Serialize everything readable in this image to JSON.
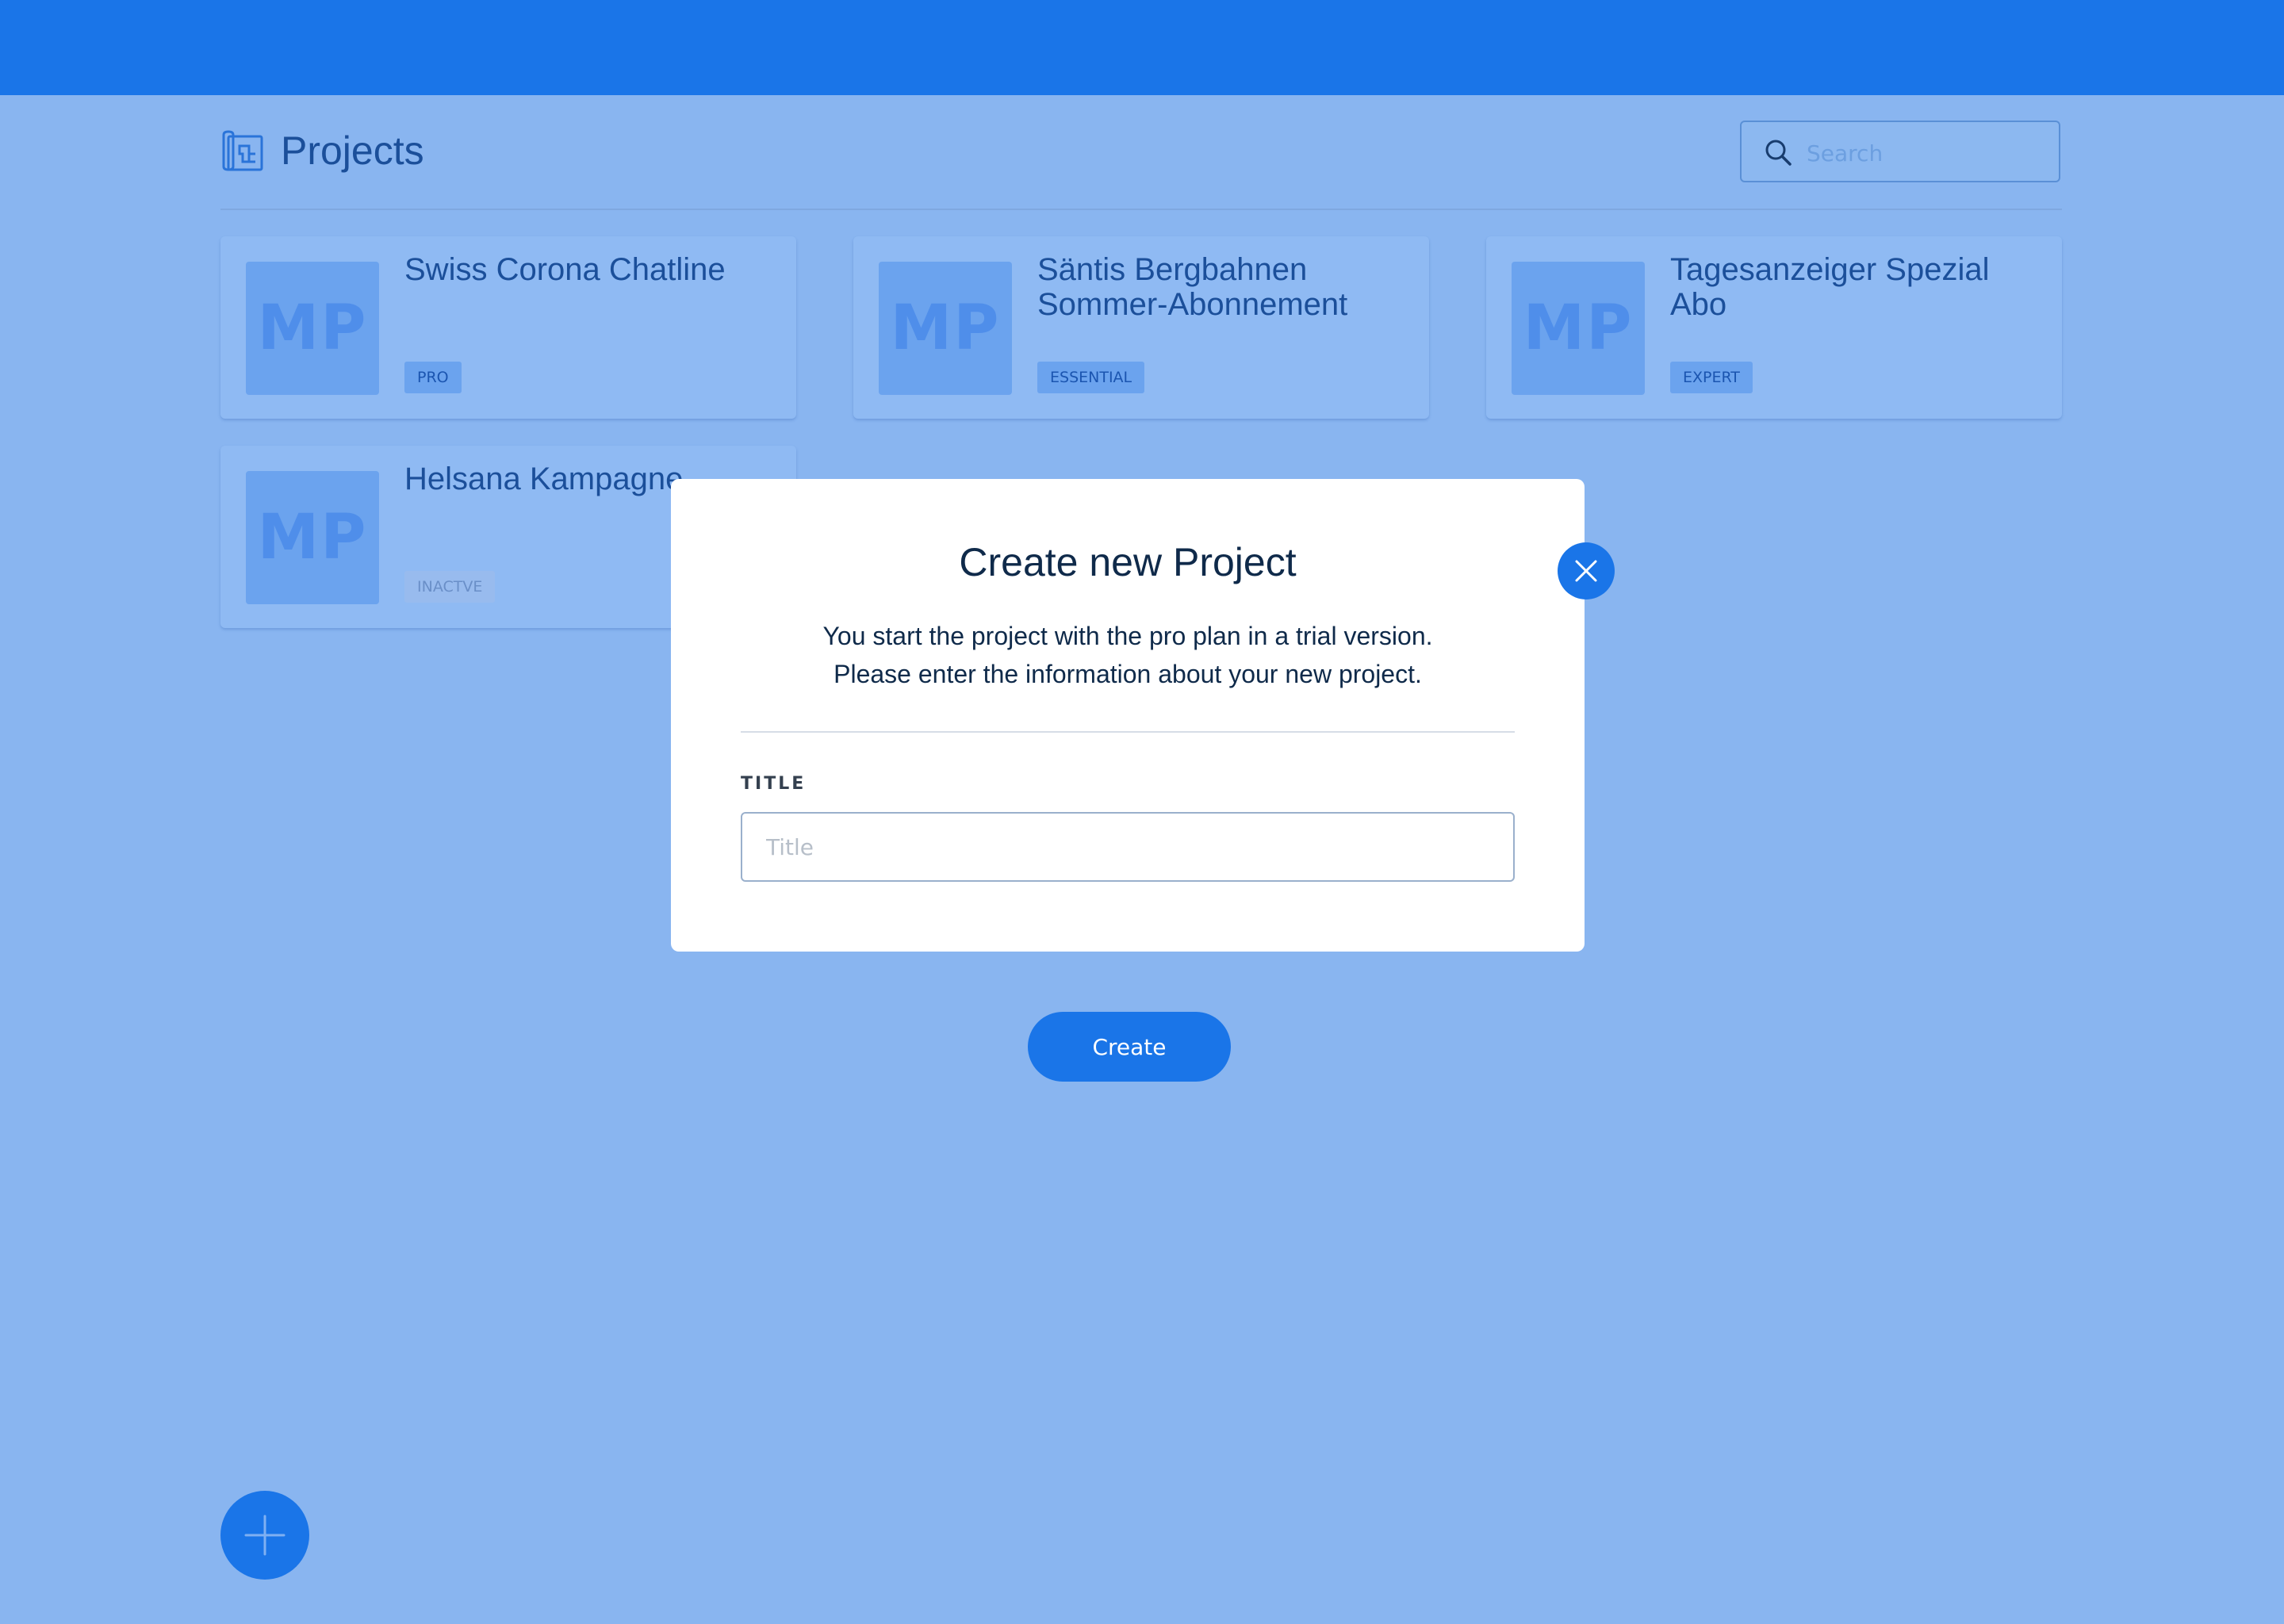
{
  "header": {
    "title": "Projects",
    "icon": "blueprint-icon"
  },
  "search": {
    "placeholder": "Search",
    "icon": "search-icon"
  },
  "projects": [
    {
      "initials": "MP",
      "title": "Swiss Corona Chatline",
      "plan": "PRO",
      "status": "active"
    },
    {
      "initials": "MP",
      "title": "Säntis Bergbahnen Sommer-Abonnement",
      "plan": "ESSENTIAL",
      "status": "active"
    },
    {
      "initials": "MP",
      "title": "Tagesanzeiger Spezial Abo",
      "plan": "EXPERT",
      "status": "active"
    },
    {
      "initials": "MP",
      "title": "Helsana Kampagne",
      "plan": "INACTVE",
      "status": "inactive"
    }
  ],
  "modal": {
    "title": "Create new Project",
    "description_line1": "You start the project with the pro plan in a trial version.",
    "description_line2": "Please enter the information about your new project.",
    "field_label": "TITLE",
    "field_placeholder": "Title",
    "field_value": "",
    "submit_label": "Create",
    "close_icon": "close-icon"
  },
  "fab": {
    "icon": "plus-icon"
  },
  "colors": {
    "primary": "#1a75e8",
    "overlay_background": "#89b5f0",
    "text_dark": "#0f2a4a",
    "text_blue": "#1b4f9a"
  }
}
